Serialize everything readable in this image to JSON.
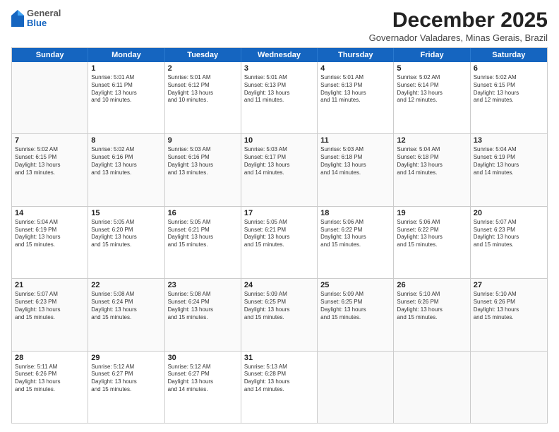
{
  "logo": {
    "general": "General",
    "blue": "Blue"
  },
  "header": {
    "month": "December 2025",
    "location": "Governador Valadares, Minas Gerais, Brazil"
  },
  "weekdays": [
    "Sunday",
    "Monday",
    "Tuesday",
    "Wednesday",
    "Thursday",
    "Friday",
    "Saturday"
  ],
  "weeks": [
    [
      {
        "day": "",
        "info": ""
      },
      {
        "day": "1",
        "info": "Sunrise: 5:01 AM\nSunset: 6:11 PM\nDaylight: 13 hours\nand 10 minutes."
      },
      {
        "day": "2",
        "info": "Sunrise: 5:01 AM\nSunset: 6:12 PM\nDaylight: 13 hours\nand 10 minutes."
      },
      {
        "day": "3",
        "info": "Sunrise: 5:01 AM\nSunset: 6:13 PM\nDaylight: 13 hours\nand 11 minutes."
      },
      {
        "day": "4",
        "info": "Sunrise: 5:01 AM\nSunset: 6:13 PM\nDaylight: 13 hours\nand 11 minutes."
      },
      {
        "day": "5",
        "info": "Sunrise: 5:02 AM\nSunset: 6:14 PM\nDaylight: 13 hours\nand 12 minutes."
      },
      {
        "day": "6",
        "info": "Sunrise: 5:02 AM\nSunset: 6:15 PM\nDaylight: 13 hours\nand 12 minutes."
      }
    ],
    [
      {
        "day": "7",
        "info": "Sunrise: 5:02 AM\nSunset: 6:15 PM\nDaylight: 13 hours\nand 13 minutes."
      },
      {
        "day": "8",
        "info": "Sunrise: 5:02 AM\nSunset: 6:16 PM\nDaylight: 13 hours\nand 13 minutes."
      },
      {
        "day": "9",
        "info": "Sunrise: 5:03 AM\nSunset: 6:16 PM\nDaylight: 13 hours\nand 13 minutes."
      },
      {
        "day": "10",
        "info": "Sunrise: 5:03 AM\nSunset: 6:17 PM\nDaylight: 13 hours\nand 14 minutes."
      },
      {
        "day": "11",
        "info": "Sunrise: 5:03 AM\nSunset: 6:18 PM\nDaylight: 13 hours\nand 14 minutes."
      },
      {
        "day": "12",
        "info": "Sunrise: 5:04 AM\nSunset: 6:18 PM\nDaylight: 13 hours\nand 14 minutes."
      },
      {
        "day": "13",
        "info": "Sunrise: 5:04 AM\nSunset: 6:19 PM\nDaylight: 13 hours\nand 14 minutes."
      }
    ],
    [
      {
        "day": "14",
        "info": "Sunrise: 5:04 AM\nSunset: 6:19 PM\nDaylight: 13 hours\nand 15 minutes."
      },
      {
        "day": "15",
        "info": "Sunrise: 5:05 AM\nSunset: 6:20 PM\nDaylight: 13 hours\nand 15 minutes."
      },
      {
        "day": "16",
        "info": "Sunrise: 5:05 AM\nSunset: 6:21 PM\nDaylight: 13 hours\nand 15 minutes."
      },
      {
        "day": "17",
        "info": "Sunrise: 5:05 AM\nSunset: 6:21 PM\nDaylight: 13 hours\nand 15 minutes."
      },
      {
        "day": "18",
        "info": "Sunrise: 5:06 AM\nSunset: 6:22 PM\nDaylight: 13 hours\nand 15 minutes."
      },
      {
        "day": "19",
        "info": "Sunrise: 5:06 AM\nSunset: 6:22 PM\nDaylight: 13 hours\nand 15 minutes."
      },
      {
        "day": "20",
        "info": "Sunrise: 5:07 AM\nSunset: 6:23 PM\nDaylight: 13 hours\nand 15 minutes."
      }
    ],
    [
      {
        "day": "21",
        "info": "Sunrise: 5:07 AM\nSunset: 6:23 PM\nDaylight: 13 hours\nand 15 minutes."
      },
      {
        "day": "22",
        "info": "Sunrise: 5:08 AM\nSunset: 6:24 PM\nDaylight: 13 hours\nand 15 minutes."
      },
      {
        "day": "23",
        "info": "Sunrise: 5:08 AM\nSunset: 6:24 PM\nDaylight: 13 hours\nand 15 minutes."
      },
      {
        "day": "24",
        "info": "Sunrise: 5:09 AM\nSunset: 6:25 PM\nDaylight: 13 hours\nand 15 minutes."
      },
      {
        "day": "25",
        "info": "Sunrise: 5:09 AM\nSunset: 6:25 PM\nDaylight: 13 hours\nand 15 minutes."
      },
      {
        "day": "26",
        "info": "Sunrise: 5:10 AM\nSunset: 6:26 PM\nDaylight: 13 hours\nand 15 minutes."
      },
      {
        "day": "27",
        "info": "Sunrise: 5:10 AM\nSunset: 6:26 PM\nDaylight: 13 hours\nand 15 minutes."
      }
    ],
    [
      {
        "day": "28",
        "info": "Sunrise: 5:11 AM\nSunset: 6:26 PM\nDaylight: 13 hours\nand 15 minutes."
      },
      {
        "day": "29",
        "info": "Sunrise: 5:12 AM\nSunset: 6:27 PM\nDaylight: 13 hours\nand 15 minutes."
      },
      {
        "day": "30",
        "info": "Sunrise: 5:12 AM\nSunset: 6:27 PM\nDaylight: 13 hours\nand 14 minutes."
      },
      {
        "day": "31",
        "info": "Sunrise: 5:13 AM\nSunset: 6:28 PM\nDaylight: 13 hours\nand 14 minutes."
      },
      {
        "day": "",
        "info": ""
      },
      {
        "day": "",
        "info": ""
      },
      {
        "day": "",
        "info": ""
      }
    ]
  ]
}
